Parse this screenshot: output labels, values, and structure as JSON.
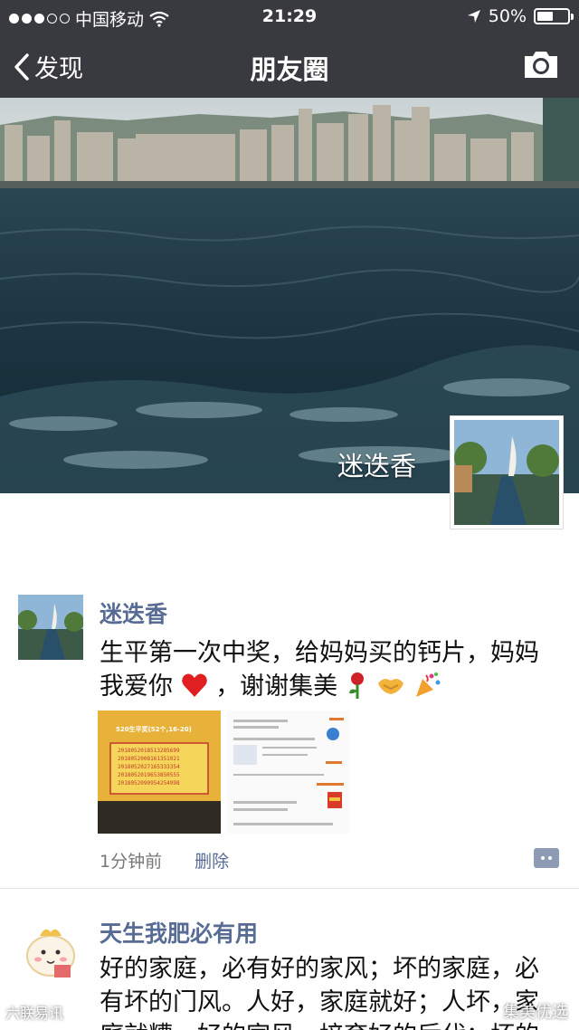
{
  "status_bar": {
    "carrier": "中国移动",
    "time": "21:29",
    "battery": "50%"
  },
  "nav": {
    "back_label": "发现",
    "title": "朋友圈"
  },
  "cover": {
    "name": "迷迭香"
  },
  "posts": [
    {
      "author": "迷迭香",
      "text_line1": "生平第一次中奖，给妈妈买的钙片，妈妈",
      "text_line2": "我爱你",
      "text_line2b": "，谢谢集美",
      "time": "1分钟前",
      "delete_label": "删除",
      "photo1": {
        "header": "520生平奖(52个,16-20)",
        "codes": [
          "2018052018513285699",
          "2018052008161351021",
          "2018052027165333354",
          "2018052019653850555",
          "2018052090954254998"
        ]
      }
    },
    {
      "author": "天生我肥必有用",
      "text_line1": "好的家庭，必有好的家风；坏的家庭，必",
      "text_line2": "有坏的门风。人好，家庭就好；人坏，家",
      "text_line3": "庭就糟。好的家风，培育好的后代；坏的"
    }
  ],
  "watermarks": {
    "left": "六联易讯",
    "right": "集美优选"
  },
  "colors": {
    "nav_bg": "#393a3f",
    "link": "#576b95"
  }
}
